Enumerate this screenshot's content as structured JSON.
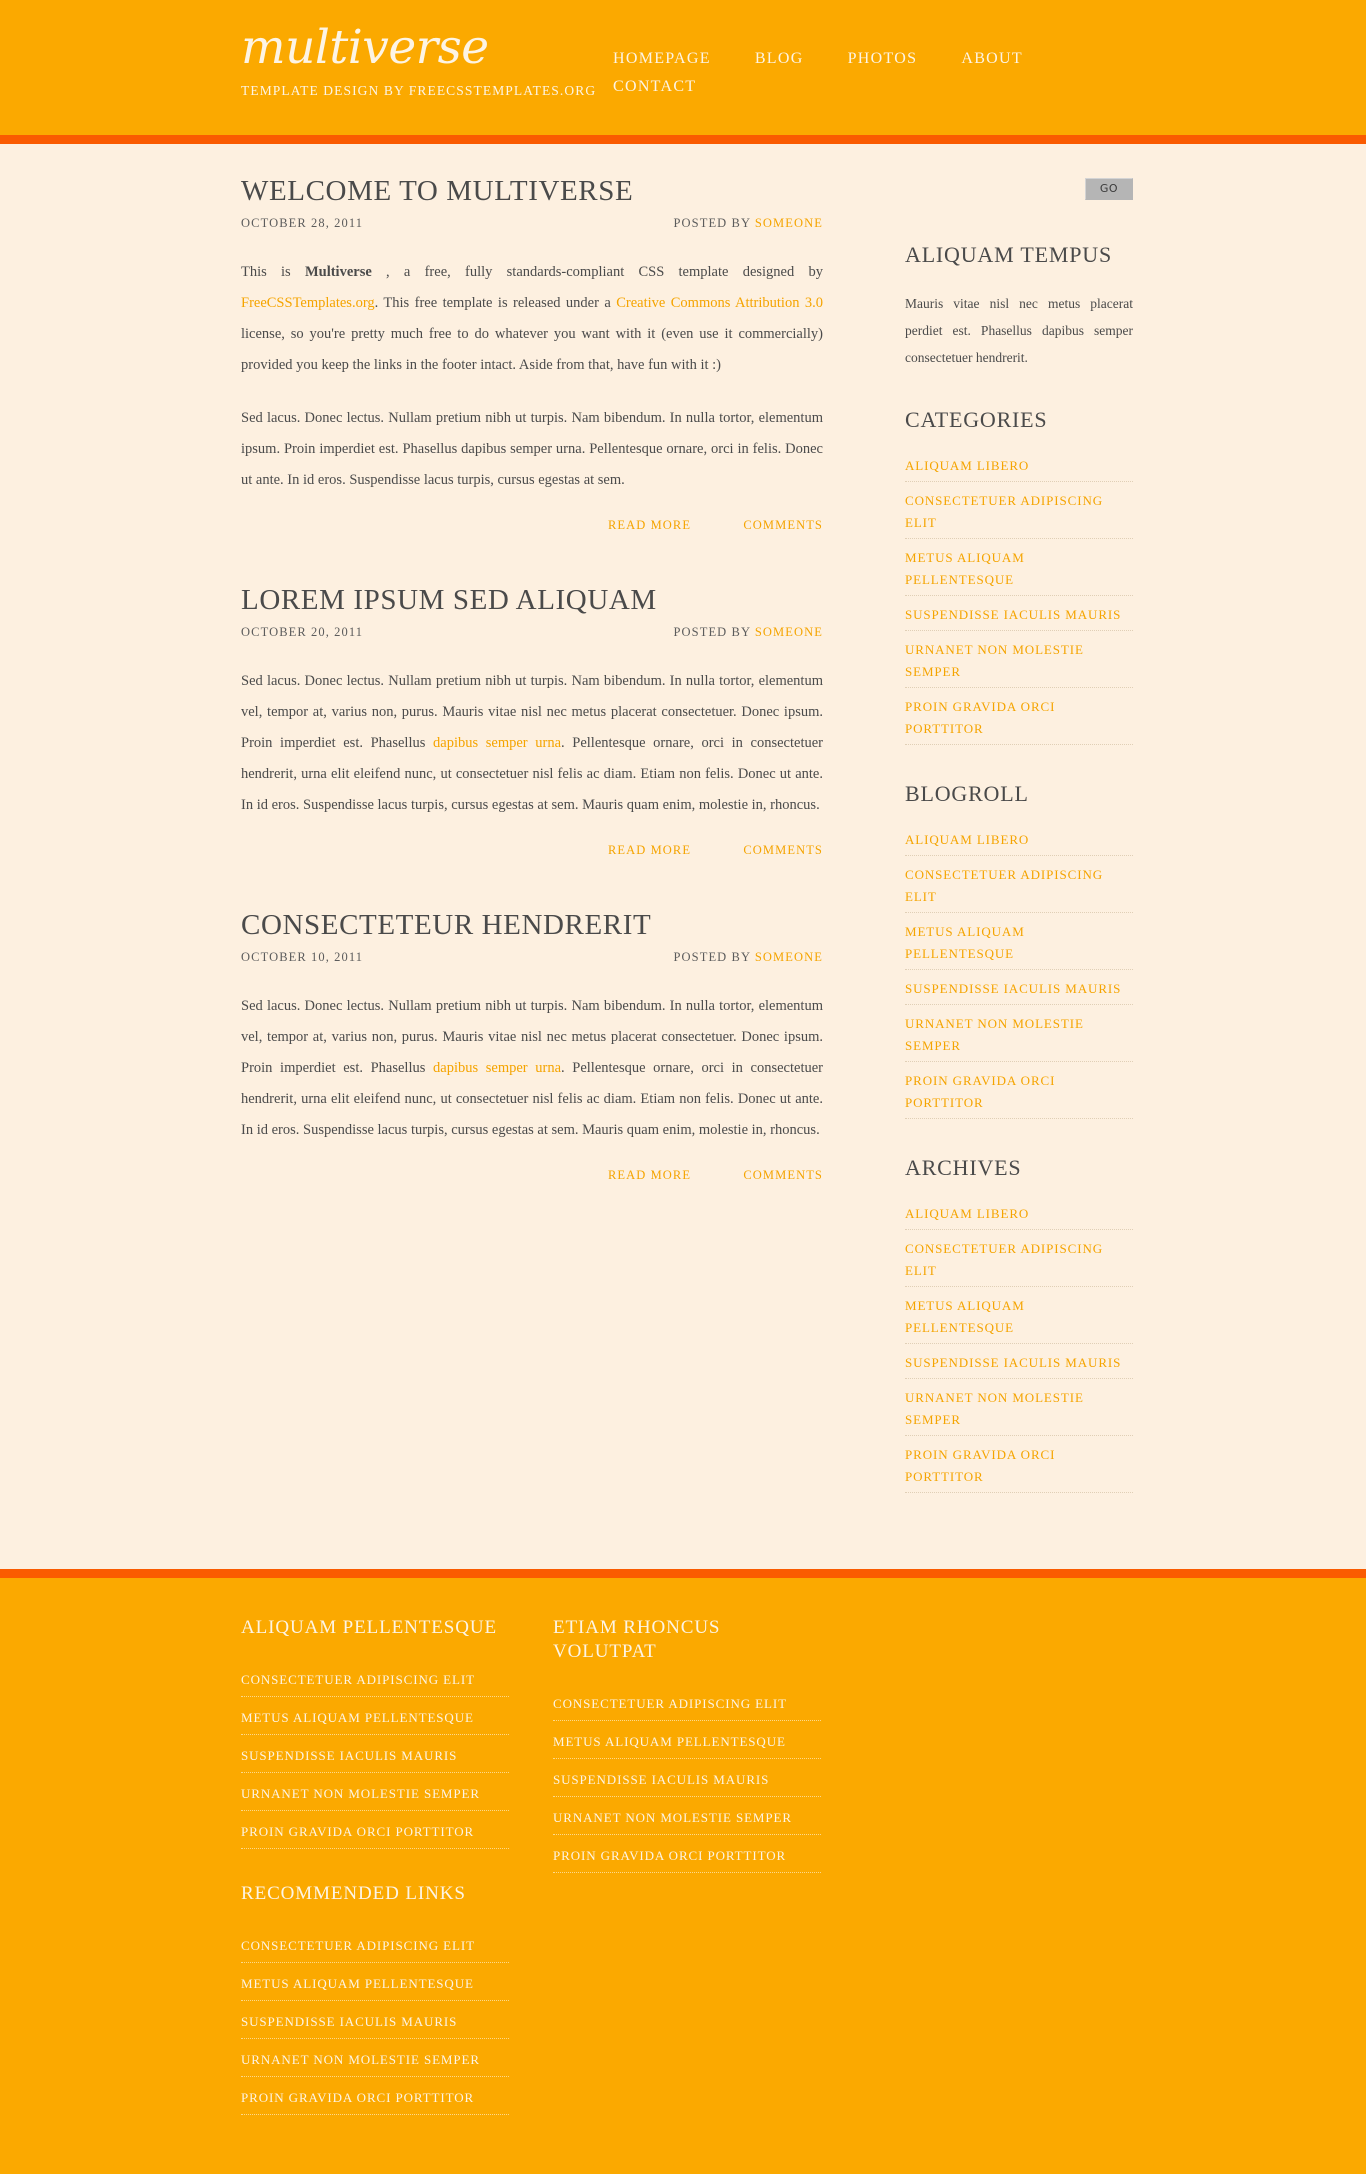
{
  "colors": {
    "header_bg": "#fba900",
    "divider": "#fa5b00",
    "page_bg": "#fdf0e0",
    "accent_link": "#f5a400",
    "heading": "#4a4a4a",
    "light_text": "#fdf4e4"
  },
  "header": {
    "logo_title": "multiverse",
    "tagline": "Template design by FreeCSSTemplates.org",
    "nav": [
      {
        "label": "Homepage"
      },
      {
        "label": "Blog"
      },
      {
        "label": "Photos"
      },
      {
        "label": "About"
      },
      {
        "label": "Contact"
      }
    ]
  },
  "search": {
    "value": "",
    "placeholder": "",
    "button_label": "GO"
  },
  "posts": [
    {
      "title": "Welcome to Multiverse",
      "date": "October 28, 2011",
      "posted_by_label": "Posted by",
      "author": "someone",
      "paragraphs": [
        "This is Multiverse , a free, fully standards-compliant CSS template designed by FreeCSSTemplates.org. This free template is released under a Creative Commons Attribution 3.0 license, so you're pretty much free to do whatever you want with it (even use it commercially) provided you keep the links in the footer intact. Aside from that, have fun with it :)",
        "Sed lacus. Donec lectus. Nullam pretium nibh ut turpis. Nam bibendum. In nulla tortor, elementum ipsum. Proin imperdiet est. Phasellus dapibus semper urna. Pellentesque ornare, orci in felis. Donec ut ante. In id eros. Suspendisse lacus turpis, cursus egestas at sem."
      ],
      "read_more": "Read More",
      "comments": "Comments"
    },
    {
      "title": "Lorem Ipsum Sed Aliquam",
      "date": "October 20, 2011",
      "posted_by_label": "Posted by",
      "author": "someone",
      "paragraphs": [
        "Sed lacus. Donec lectus. Nullam pretium nibh ut turpis. Nam bibendum. In nulla tortor, elementum vel, tempor at, varius non, purus. Mauris vitae nisl nec metus placerat consectetuer. Donec ipsum. Proin imperdiet est. Phasellus dapibus semper urna. Pellentesque ornare, orci in consectetuer hendrerit, urna elit eleifend nunc, ut consectetuer nisl felis ac diam. Etiam non felis. Donec ut ante. In id eros. Suspendisse lacus turpis, cursus egestas at sem. Mauris quam enim, molestie in, rhoncus."
      ],
      "read_more": "Read More",
      "comments": "Comments"
    },
    {
      "title": "Consecteteur Hendrerit",
      "date": "October 10, 2011",
      "posted_by_label": "Posted by",
      "author": "someone",
      "paragraphs": [
        "Sed lacus. Donec lectus. Nullam pretium nibh ut turpis. Nam bibendum. In nulla tortor, elementum vel, tempor at, varius non, purus. Mauris vitae nisl nec metus placerat consectetuer. Donec ipsum. Proin imperdiet est. Phasellus dapibus semper urna. Pellentesque ornare, orci in consectetuer hendrerit, urna elit eleifend nunc, ut consectetuer nisl felis ac diam. Etiam non felis. Donec ut ante. In id eros. Suspendisse lacus turpis, cursus egestas at sem. Mauris quam enim, molestie in, rhoncus."
      ],
      "read_more": "Read More",
      "comments": "Comments"
    }
  ],
  "post_inline": {
    "p1_a": "This is ",
    "p1_strong": "Multiverse",
    "p1_b": " , a free, fully standards-compliant CSS template designed by ",
    "p1_link1": "FreeCSSTemplates.org",
    "p1_c": ". This free template is released under a ",
    "p1_link2": "Creative Commons Attribution 3.0",
    "p1_d": " license, so you're pretty much free to do whatever you want with it (even use it commercially) provided you keep the links in the footer intact. Aside from that, have fun with it :)",
    "p2_a": "Sed lacus. Donec lectus. Nullam pretium nibh ut turpis. Nam bibendum. In nulla tortor, elementum vel, tempor at, varius non, purus. Mauris vitae nisl nec metus placerat consectetuer. Donec ipsum. Proin imperdiet est. Phasellus ",
    "p2_link": "dapibus semper urna",
    "p2_b": ". Pellentesque ornare, orci in consectetuer hendrerit, urna elit eleifend nunc, ut consectetuer nisl felis ac diam. Etiam non felis. Donec ut ante. In id eros. Suspendisse lacus turpis, cursus egestas at sem. Mauris quam enim, molestie in, rhoncus."
  },
  "sidebar": {
    "widgets": [
      {
        "title": "Aliquam Tempus",
        "type": "text",
        "text": "Mauris vitae nisl nec metus placerat perdiet est. Phasellus dapibus semper consectetuer hendrerit."
      },
      {
        "title": "Categories",
        "type": "list",
        "items": [
          "Aliquam libero",
          "Consectetuer adipiscing elit",
          "Metus aliquam pellentesque",
          "Suspendisse iaculis mauris",
          "Urnanet non molestie semper",
          "Proin gravida orci porttitor"
        ]
      },
      {
        "title": "Blogroll",
        "type": "list",
        "items": [
          "Aliquam libero",
          "Consectetuer adipiscing elit",
          "Metus aliquam pellentesque",
          "Suspendisse iaculis mauris",
          "Urnanet non molestie semper",
          "Proin gravida orci porttitor"
        ]
      },
      {
        "title": "Archives",
        "type": "list",
        "items": [
          "Aliquam libero",
          "Consectetuer adipiscing elit",
          "Metus aliquam pellentesque",
          "Suspendisse iaculis mauris",
          "Urnanet non molestie semper",
          "Proin gravida orci porttitor"
        ]
      }
    ]
  },
  "footer": {
    "columns": [
      {
        "title": "Aliquam Pellentesque",
        "items": [
          "Consectetuer adipiscing elit",
          "Metus aliquam pellentesque",
          "Suspendisse iaculis mauris",
          "Urnanet non molestie semper",
          "Proin gravida orci porttitor"
        ]
      },
      {
        "title": "Etiam Rhoncus Volutpat",
        "items": [
          "Consectetuer adipiscing elit",
          "Metus aliquam pellentesque",
          "Suspendisse iaculis mauris",
          "Urnanet non molestie semper",
          "Proin gravida orci porttitor"
        ]
      },
      {
        "title": "Recommended Links",
        "items": [
          "Consectetuer adipiscing elit",
          "Metus aliquam pellentesque",
          "Suspendisse iaculis mauris",
          "Urnanet non molestie semper",
          "Proin gravida orci porttitor"
        ]
      }
    ]
  }
}
